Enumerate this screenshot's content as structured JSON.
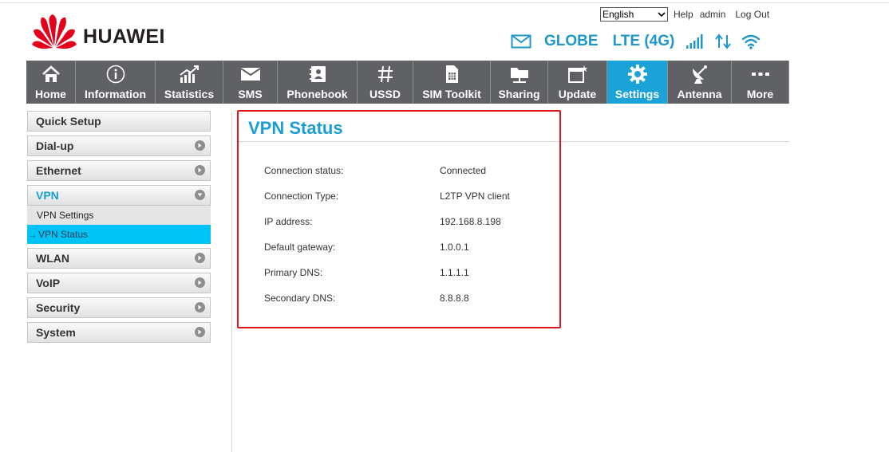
{
  "brand": {
    "name": "HUAWEI"
  },
  "topbar": {
    "language": "English",
    "help": "Help",
    "user": "admin",
    "logout": "Log Out"
  },
  "status": {
    "operator": "GLOBE",
    "network": "LTE (4G)"
  },
  "nav": [
    {
      "label": "Home",
      "icon": "home-icon"
    },
    {
      "label": "Information",
      "icon": "info-icon"
    },
    {
      "label": "Statistics",
      "icon": "chart-icon"
    },
    {
      "label": "SMS",
      "icon": "envelope-icon"
    },
    {
      "label": "Phonebook",
      "icon": "contact-book-icon"
    },
    {
      "label": "USSD",
      "icon": "hash-icon"
    },
    {
      "label": "SIM Toolkit",
      "icon": "sim-card-icon"
    },
    {
      "label": "Sharing",
      "icon": "folder-share-icon"
    },
    {
      "label": "Update",
      "icon": "update-window-icon"
    },
    {
      "label": "Settings",
      "icon": "gear-icon",
      "active": true
    },
    {
      "label": "Antenna",
      "icon": "satellite-dish-icon"
    },
    {
      "label": "More",
      "icon": "more-dots-icon"
    }
  ],
  "sidebar": {
    "quick_setup": "Quick Setup",
    "dialup": "Dial-up",
    "ethernet": "Ethernet",
    "vpn": "VPN",
    "vpn_settings": "VPN Settings",
    "vpn_status": "VPN Status",
    "wlan": "WLAN",
    "voip": "VoIP",
    "security": "Security",
    "system": "System"
  },
  "main": {
    "title": "VPN Status",
    "rows": [
      {
        "label": "Connection status:",
        "value": "Connected"
      },
      {
        "label": "Connection Type:",
        "value": "L2TP VPN client"
      },
      {
        "label": "IP address:",
        "value": "192.168.8.198"
      },
      {
        "label": "Default gateway:",
        "value": "1.0.0.1"
      },
      {
        "label": "Primary DNS:",
        "value": "1.1.1.1"
      },
      {
        "label": "Secondary DNS:",
        "value": "8.8.8.8"
      }
    ]
  },
  "colors": {
    "accent": "#1b9ed3",
    "nav_bg": "#5f6164",
    "nav_active": "#1ba3d9",
    "highlight": "#e4141b",
    "logo_red": "#e3001b"
  }
}
